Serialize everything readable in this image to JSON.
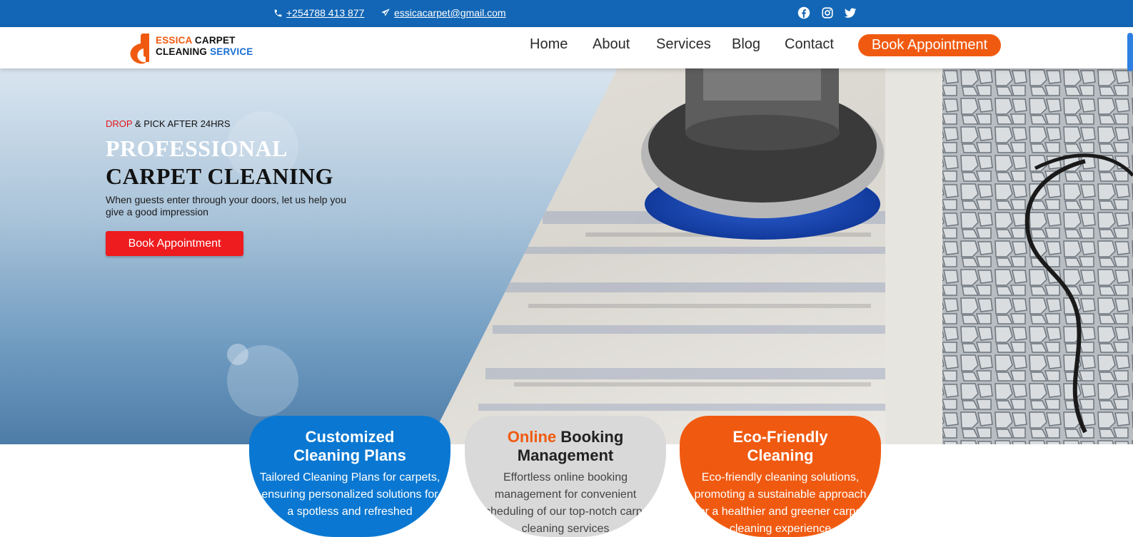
{
  "topbar": {
    "phone": "+254788 413 877",
    "email": "essicacarpet@gmail.com",
    "social": [
      "facebook-icon",
      "instagram-icon",
      "twitter-icon"
    ]
  },
  "logo": {
    "line1_a": "ESSICA",
    "line1_b": "CARPET",
    "line2_a": "CLEANING",
    "line2_b": "SERVICE"
  },
  "nav": {
    "items": [
      "Home",
      "About",
      "Services",
      "Blog",
      "Contact"
    ],
    "cta": "Book Appointment"
  },
  "hero": {
    "tag_red": "DROP",
    "tag_rest": "& PICK AFTER 24HRS",
    "title_line1": "PROFESSIONAL",
    "title_line2": "CARPET CLEANING",
    "subtitle": "When guests enter through your doors, let us help you give a good impression",
    "button": "Book Appointment"
  },
  "cards": [
    {
      "title_line1": "Customized",
      "title_line2": "Cleaning Plans",
      "text": "Tailored Cleaning Plans for carpets, ensuring personalized solutions for a spotless and refreshed"
    },
    {
      "title_accent": "Online",
      "title_rest": "Booking",
      "title_line2": "Management",
      "text": "Effortless online booking management for convenient scheduling of our top-notch carpet cleaning services"
    },
    {
      "title_line1": "Eco-Friendly",
      "title_line2": "Cleaning",
      "text": "Eco-friendly cleaning solutions, promoting a sustainable approach for a healthier and greener carpet cleaning experience"
    }
  ],
  "colors": {
    "topbar": "#1266b5",
    "accent_orange": "#f05a10",
    "hero_button_red": "#ee1b1f",
    "card_blue": "#0a78d2",
    "card_gray": "#d9d9d9"
  }
}
